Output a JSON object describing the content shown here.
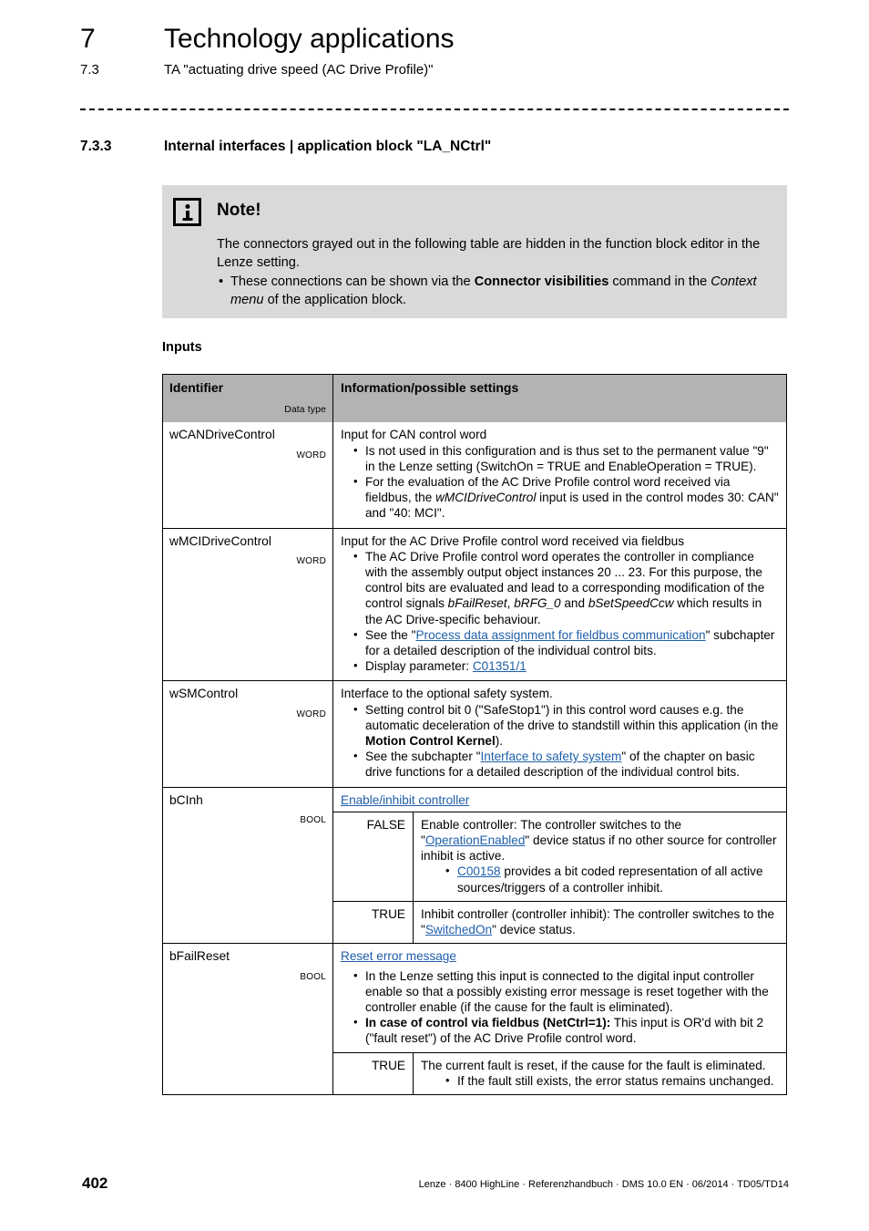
{
  "header": {
    "chapter_number": "7",
    "chapter_title": "Technology applications",
    "section_number": "7.3",
    "section_title": "TA \"actuating drive speed (AC Drive Profile)\""
  },
  "section": {
    "number": "7.3.3",
    "title": "Internal interfaces | application block \"LA_NCtrl\""
  },
  "note": {
    "icon": "info-icon",
    "title": "Note!",
    "paragraph": "The connectors grayed out in the following table are hidden in the function block editor in the Lenze setting.",
    "bullet_parts": {
      "pre": "These connections can be shown via the ",
      "bold": "Connector visibilities",
      "mid": " command in the ",
      "italic": "Context menu",
      "post": " of the application block."
    },
    "background_color": "#d9d9d9"
  },
  "table": {
    "caption": "Inputs",
    "header": {
      "identifier": "Identifier",
      "data_type": "Data type",
      "information": "Information/possible settings"
    },
    "rows": [
      {
        "identifier": "wCANDriveControl",
        "data_type": "WORD",
        "lead": "Input for CAN control word",
        "bullets": [
          {
            "parts": [
              {
                "t": "Is not used in this configuration and is thus set to the permanent value \"9\" in the Lenze setting (SwitchOn = TRUE and EnableOperation = TRUE)."
              }
            ]
          },
          {
            "parts": [
              {
                "t": "For the evaluation of the AC Drive Profile control word received via fieldbus, the "
              },
              {
                "t": "wMCIDriveControl",
                "s": "i"
              },
              {
                "t": " input is used in the control modes 30: CAN\" and \"40: MCI\"."
              }
            ]
          }
        ]
      },
      {
        "identifier": "wMCIDriveControl",
        "data_type": "WORD",
        "lead": "Input for the AC Drive Profile control word received via fieldbus",
        "bullets": [
          {
            "parts": [
              {
                "t": "The AC Drive Profile control word operates the controller in compliance with the assembly output object instances 20 ... 23. For this purpose, the control bits are evaluated and lead to a corresponding modification of the control signals "
              },
              {
                "t": "bFailReset",
                "s": "i"
              },
              {
                "t": ", "
              },
              {
                "t": "bRFG_0",
                "s": "i"
              },
              {
                "t": " and "
              },
              {
                "t": "bSetSpeedCcw",
                "s": "i"
              },
              {
                "t": " which results in the AC Drive-specific behaviour."
              }
            ]
          },
          {
            "parts": [
              {
                "t": "See the \""
              },
              {
                "t": "Process data assignment for fieldbus communication",
                "s": "link"
              },
              {
                "t": "\" subchapter for a detailed description of the individual control bits."
              }
            ]
          },
          {
            "parts": [
              {
                "t": "Display parameter: "
              },
              {
                "t": "C01351/1",
                "s": "link"
              }
            ]
          }
        ]
      },
      {
        "identifier": "wSMControl",
        "data_type": "WORD",
        "lead": "Interface to the optional safety system.",
        "bullets": [
          {
            "parts": [
              {
                "t": "Setting control bit 0 (\"SafeStop1\") in this control word causes e.g. the automatic deceleration of the drive to standstill within this application (in the "
              },
              {
                "t": "Motion Control Kernel",
                "s": "b"
              },
              {
                "t": ")."
              }
            ]
          },
          {
            "parts": [
              {
                "t": "See the subchapter \""
              },
              {
                "t": "Interface to safety system",
                "s": "link"
              },
              {
                "t": "\" of the chapter on basic drive functions for a detailed description of the individual control bits."
              }
            ]
          }
        ]
      },
      {
        "identifier": "bCInh",
        "data_type": "BOOL",
        "head_link": "Enable/inhibit controller",
        "values": [
          {
            "value": "FALSE",
            "parts": [
              {
                "t": "Enable controller: The controller switches to the \""
              },
              {
                "t": "OperationEnabled",
                "s": "link"
              },
              {
                "t": "\" device status if no other source for controller inhibit is active."
              }
            ],
            "bullets": [
              {
                "parts": [
                  {
                    "t": "C00158",
                    "s": "link"
                  },
                  {
                    "t": " provides a bit coded representation of all active sources/triggers of a controller inhibit."
                  }
                ]
              }
            ]
          },
          {
            "value": "TRUE",
            "parts": [
              {
                "t": "Inhibit controller (controller inhibit): The controller switches to the \""
              },
              {
                "t": "SwitchedOn",
                "s": "link"
              },
              {
                "t": "\" device status."
              }
            ],
            "bullets": []
          }
        ]
      },
      {
        "identifier": "bFailReset",
        "data_type": "BOOL",
        "head_link": "Reset error message",
        "head_bullets": [
          {
            "parts": [
              {
                "t": "In the Lenze setting this input is connected to the digital input controller enable so that a possibly existing error message is reset together with the controller enable (if the cause for the fault is eliminated)."
              }
            ]
          },
          {
            "parts": [
              {
                "t": "In case of control via fieldbus (NetCtrl=1):",
                "s": "b"
              },
              {
                "t": " This input is OR'd with bit 2 (\"fault reset\") of the AC Drive Profile control word."
              }
            ]
          }
        ],
        "values": [
          {
            "value": "TRUE",
            "parts": [
              {
                "t": "The current fault is reset, if the cause for the fault is eliminated."
              }
            ],
            "bullets": [
              {
                "parts": [
                  {
                    "t": "If the fault still exists, the error status remains unchanged."
                  }
                ]
              }
            ]
          }
        ]
      }
    ]
  },
  "footer": {
    "page_number": "402",
    "text": "Lenze · 8400 HighLine · Referenzhandbuch · DMS 10.0 EN · 06/2014 · TD05/TD14"
  },
  "colors": {
    "link": "#1f5faa",
    "note_bg": "#d9d9d9",
    "table_header_bg": "#b3b3b3"
  }
}
